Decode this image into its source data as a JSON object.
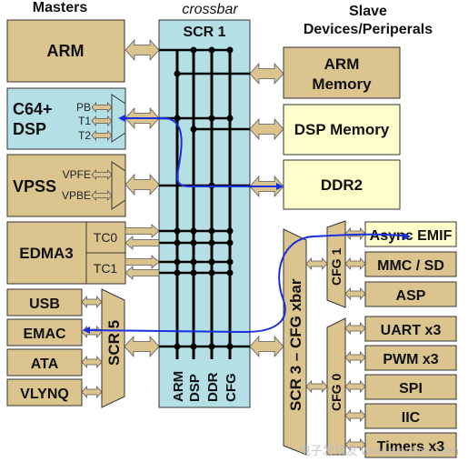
{
  "headings": {
    "masters": "Masters",
    "crossbar": "crossbar",
    "slaves_line1": "Slave",
    "slaves_line2": "Devices/Periperals"
  },
  "colors": {
    "tan": "#dcc48f",
    "light_blue": "#b3dfe5",
    "light_yellow": "#ffffcc",
    "path_blue": "#1a2fe0"
  },
  "masters": {
    "arm": "ARM",
    "dsp": {
      "line1": "C64+",
      "line2": "DSP",
      "ports": [
        "PB",
        "T1",
        "T2"
      ]
    },
    "vpss": {
      "label": "VPSS",
      "ports": [
        "VPFE",
        "VPBE"
      ]
    },
    "edma": {
      "label": "EDMA3",
      "ports": [
        "TC0",
        "TC1"
      ]
    },
    "peripherals": [
      "USB",
      "EMAC",
      "ATA",
      "VLYNQ"
    ],
    "scr5": "SCR 5"
  },
  "scr1": {
    "title": "SCR 1",
    "columns": [
      "ARM",
      "DSP",
      "DDR",
      "CFG"
    ]
  },
  "slaves": {
    "arm_memory": {
      "line1": "ARM",
      "line2": "Memory"
    },
    "dsp_memory": "DSP Memory",
    "ddr2": "DDR2",
    "scr3": "SCR 3 – CFG xbar",
    "cfg1": "CFG 1",
    "cfg0": "CFG 0",
    "cfg1_devices": [
      "Async EMIF",
      "MMC / SD",
      "ASP"
    ],
    "cfg0_devices": [
      "UART x3",
      "PWM x3",
      "SPI",
      "IIC",
      "Timers x3"
    ]
  },
  "watermark": "电子发烧友 www.elecfans.com"
}
